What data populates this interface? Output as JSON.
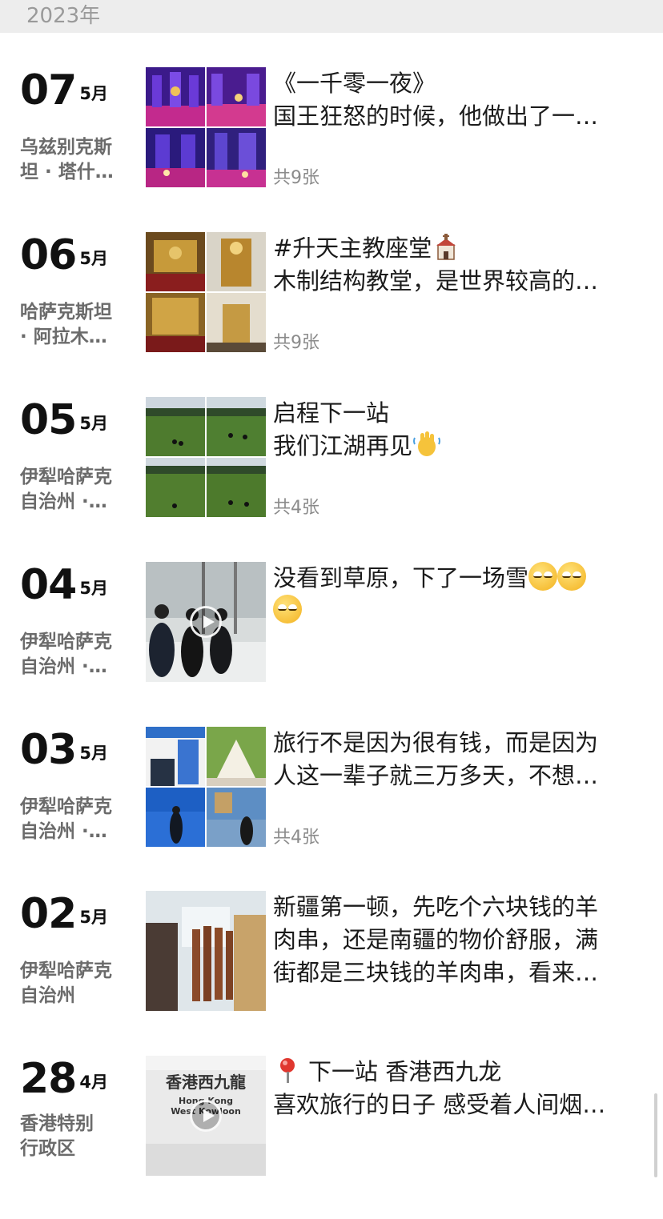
{
  "year_label": "2023年",
  "posts": [
    {
      "day": "07",
      "month": "5月",
      "location": [
        "乌兹别克斯",
        "坦 · 塔什…"
      ],
      "lines": [
        "《一千零一夜》",
        "国王狂怒的时候，他做出了一…"
      ],
      "count": "共9张"
    },
    {
      "day": "06",
      "month": "5月",
      "location": [
        "哈萨克斯坦",
        " · 阿拉木…"
      ],
      "lines": [
        "#升天主教座堂",
        "木制结构教堂，是世界较高的…"
      ],
      "count": "共9张"
    },
    {
      "day": "05",
      "month": "5月",
      "location": [
        "伊犁哈萨克",
        "自治州 ·…"
      ],
      "lines": [
        "启程下一站",
        "我们江湖再见"
      ],
      "count": "共4张"
    },
    {
      "day": "04",
      "month": "5月",
      "location": [
        "伊犁哈萨克",
        "自治州 ·…"
      ],
      "lines": [
        "没看到草原，下了一场雪",
        ""
      ],
      "count": ""
    },
    {
      "day": "03",
      "month": "5月",
      "location": [
        "伊犁哈萨克",
        "自治州 ·…"
      ],
      "lines": [
        "旅行不是因为很有钱，而是因为",
        "人这一辈子就三万多天，不想…"
      ],
      "count": "共4张"
    },
    {
      "day": "02",
      "month": "5月",
      "location": [
        "伊犁哈萨克",
        "自治州"
      ],
      "lines": [
        "新疆第一顿，先吃个六块钱的羊",
        "肉串，还是南疆的物价舒服，满",
        "街都是三块钱的羊肉串，看来…"
      ],
      "count": ""
    },
    {
      "day": "28",
      "month": "4月",
      "location": [
        "香港特别",
        "行政区"
      ],
      "lines": [
        "下一站 香港西九龙",
        "",
        "喜欢旅行的日子 感受着人间烟…"
      ],
      "count": ""
    }
  ],
  "hk_sign": {
    "zh": "香港西九龍",
    "en1": "Hong Kong",
    "en2": "West Kowloon"
  },
  "icons": {
    "church": "church-icon",
    "wave": "waving-hand-icon",
    "roll": "face-with-rolling-eyes-icon",
    "pin": "round-pushpin-icon",
    "play": "play-icon"
  }
}
